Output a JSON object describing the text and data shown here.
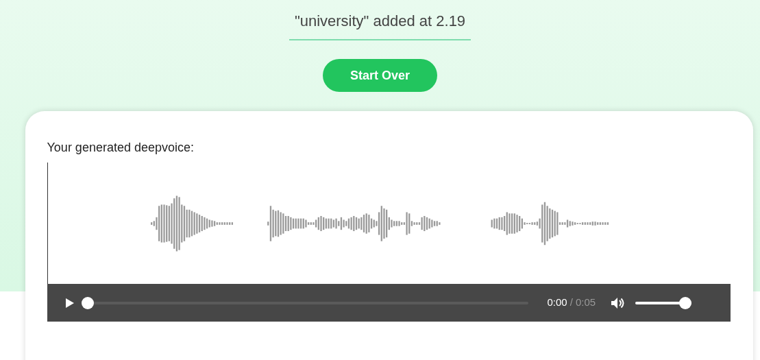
{
  "banner": {
    "message": "\"university\" added at 2.19",
    "button": "Start Over"
  },
  "card": {
    "label": "Your generated deepvoice:"
  },
  "player": {
    "playing": false,
    "progress": {
      "level": 0
    },
    "current_time": "0:00",
    "separator": "/",
    "duration": "0:05",
    "muted": false,
    "volume": {
      "level": 1
    }
  }
}
